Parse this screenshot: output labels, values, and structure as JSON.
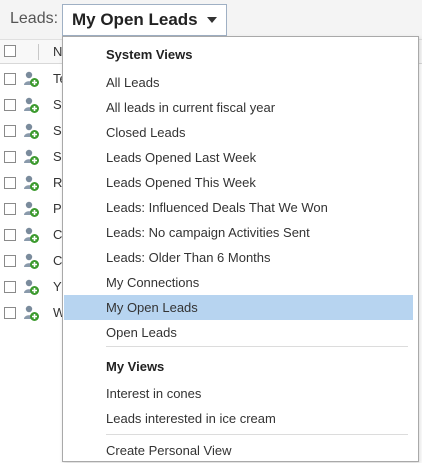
{
  "header": {
    "label": "Leads:",
    "selected_view": "My Open Leads"
  },
  "grid": {
    "name_column": "N",
    "rows": [
      {
        "text": "Te"
      },
      {
        "text": "St"
      },
      {
        "text": "Si"
      },
      {
        "text": "Sc"
      },
      {
        "text": "R"
      },
      {
        "text": "P"
      },
      {
        "text": "C"
      },
      {
        "text": "C"
      },
      {
        "text": "Y"
      },
      {
        "text": "W"
      }
    ]
  },
  "menu": {
    "system_views_title": "System Views",
    "system_views": [
      "All Leads",
      "All leads in current fiscal year",
      "Closed Leads",
      "Leads Opened Last Week",
      "Leads Opened This Week",
      "Leads: Influenced Deals That We Won",
      "Leads: No campaign Activities Sent",
      "Leads: Older Than 6 Months",
      "My Connections",
      "My Open Leads",
      "Open Leads"
    ],
    "selected_index": 9,
    "my_views_title": "My Views",
    "my_views": [
      "Interest in cones",
      "Leads interested in ice cream"
    ],
    "create_personal_view": "Create Personal View"
  },
  "colors": {
    "selected_bg": "#b7d4f0",
    "border": "#9fb0c4"
  }
}
